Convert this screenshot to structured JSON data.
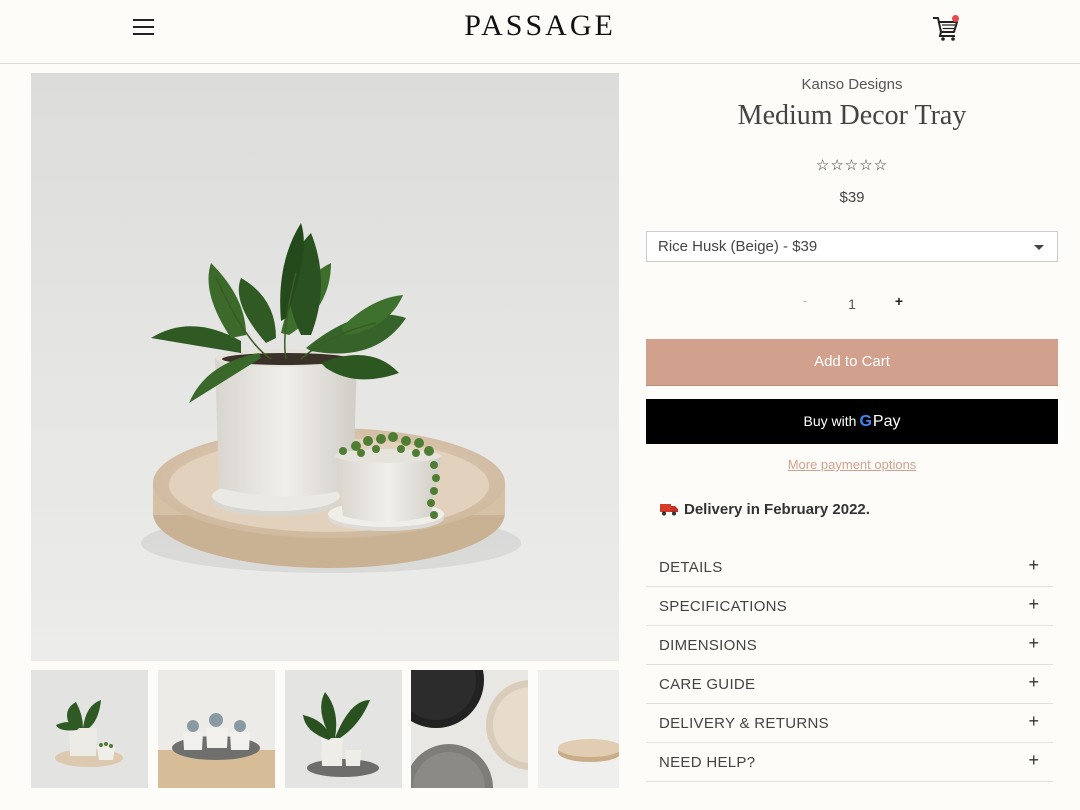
{
  "header": {
    "logo": "PASSAGE",
    "menu_icon": "hamburger-menu-icon",
    "cart_icon": "shopping-cart-icon",
    "cart_badge_color": "#e84a4a"
  },
  "product": {
    "brand": "Kanso Designs",
    "title": "Medium Decor Tray",
    "rating_stars": "☆☆☆☆☆",
    "rating_value": 0,
    "price": "$39",
    "variant": "Rice Husk (Beige) - $39",
    "quantity": {
      "minus": "-",
      "value": "1",
      "plus": "+"
    },
    "add_to_cart": "Add to Cart",
    "buy_with": "Buy with",
    "gpay_g": "G",
    "gpay_pay": "Pay",
    "more_payment": "More payment options",
    "delivery": "Delivery in February 2022.",
    "delivery_icon": "delivery-truck-icon"
  },
  "accordion": [
    {
      "label": "DETAILS",
      "icon": "+"
    },
    {
      "label": "SPECIFICATIONS",
      "icon": "+"
    },
    {
      "label": "DIMENSIONS",
      "icon": "+"
    },
    {
      "label": "CARE GUIDE",
      "icon": "+"
    },
    {
      "label": "DELIVERY & RETURNS",
      "icon": "+"
    },
    {
      "label": "NEED HELP?",
      "icon": "+"
    }
  ],
  "colors": {
    "background": "#fdfcf8",
    "accent": "#d2a18d",
    "gpay_button": "#000000"
  }
}
